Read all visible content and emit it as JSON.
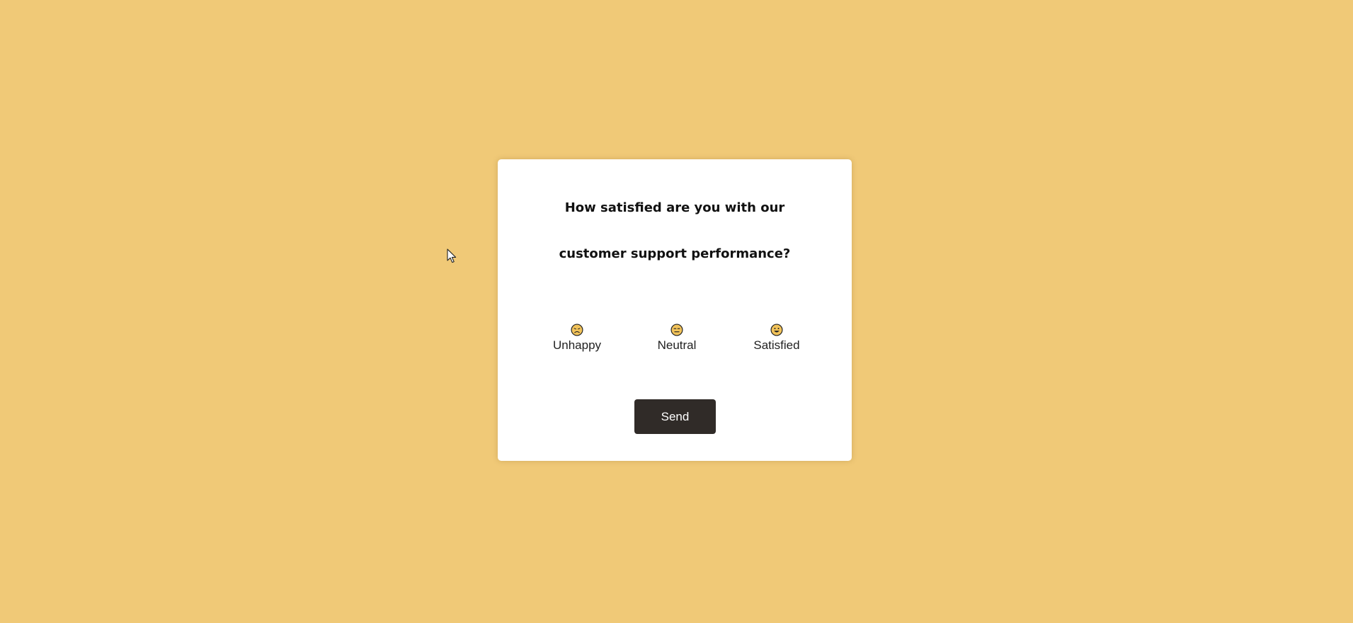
{
  "colors": {
    "background": "#f0c977",
    "card": "#ffffff",
    "button": "#302b28",
    "face": "#f2c35a"
  },
  "survey": {
    "question_line1": "How satisfied are you with our",
    "question_line2": "customer support performance?",
    "options": [
      {
        "icon": "unhappy-face-icon",
        "label": "Unhappy"
      },
      {
        "icon": "neutral-face-icon",
        "label": "Neutral"
      },
      {
        "icon": "satisfied-face-icon",
        "label": "Satisfied"
      }
    ],
    "send_label": "Send"
  },
  "cursor": {
    "icon": "mouse-pointer-icon"
  }
}
